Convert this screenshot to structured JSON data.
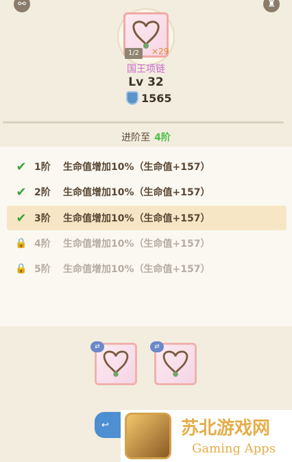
{
  "header": {
    "left_icon": "link-icon",
    "right_icon": "bag-icon"
  },
  "item": {
    "badge": "1/2",
    "count": "×29",
    "name": "国王项链",
    "level": "Lv 32",
    "power": "1565"
  },
  "advance": {
    "label": "进阶至",
    "value": "4阶"
  },
  "tiers": [
    {
      "tier": "1阶",
      "desc": "生命值增加10%（生命值+157）",
      "status": "done"
    },
    {
      "tier": "2阶",
      "desc": "生命值增加10%（生命值+157）",
      "status": "done"
    },
    {
      "tier": "3阶",
      "desc": "生命值增加10%（生命值+157）",
      "status": "done"
    },
    {
      "tier": "4阶",
      "desc": "生命值增加10%（生命值+157）",
      "status": "locked"
    },
    {
      "tier": "5阶",
      "desc": "生命值增加10%（生命值+157）",
      "status": "locked"
    }
  ],
  "colors": {
    "accent": "#4cc046",
    "item_name": "#c96acc",
    "button": "#4d8fd1"
  },
  "materials": [
    {
      "badge": "⇄"
    },
    {
      "badge": "⇄"
    }
  ],
  "action": {
    "label": "↩"
  },
  "watermark": {
    "title": "苏北游戏网",
    "subtitle": "Gaming Apps"
  }
}
